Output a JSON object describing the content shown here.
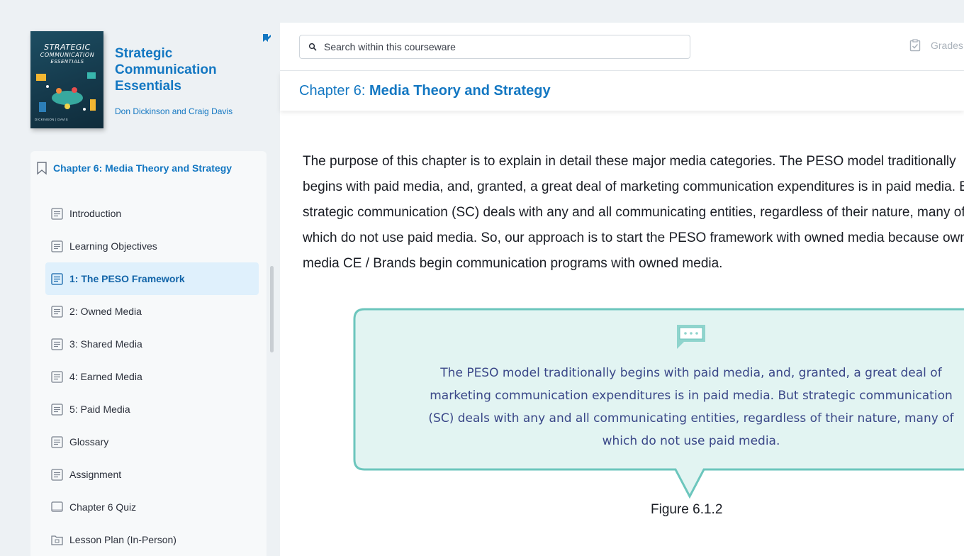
{
  "book": {
    "title": "Strategic Communication Essentials",
    "authors": "Don Dickinson and Craig Davis",
    "cover": {
      "title_line1": "STRATEGIC",
      "title_line2": "COMMUNICATION",
      "title_line3": "ESSENTIALS",
      "authors": "DICKINSON | DAVIS"
    }
  },
  "toc": {
    "chapter": "Chapter 6: Media Theory and Strategy",
    "items": [
      {
        "label": "Introduction",
        "icon": "document-icon"
      },
      {
        "label": "Learning Objectives",
        "icon": "document-icon"
      },
      {
        "label": "1: The PESO Framework",
        "icon": "document-icon",
        "active": true
      },
      {
        "label": "2: Owned Media",
        "icon": "document-icon"
      },
      {
        "label": "3: Shared Media",
        "icon": "document-icon"
      },
      {
        "label": "4: Earned Media",
        "icon": "document-icon"
      },
      {
        "label": "5: Paid Media",
        "icon": "document-icon"
      },
      {
        "label": "Glossary",
        "icon": "document-icon"
      },
      {
        "label": "Assignment",
        "icon": "document-icon"
      },
      {
        "label": "Chapter 6 Quiz",
        "icon": "quiz-icon"
      },
      {
        "label": "Lesson Plan (In-Person)",
        "icon": "folder-icon"
      }
    ]
  },
  "topbar": {
    "search_placeholder": "Search within this courseware",
    "grades_label": "Grades"
  },
  "chapter_header": {
    "prefix": "Chapter 6: ",
    "title": "Media Theory and Strategy"
  },
  "content": {
    "lines": [
      "The purpose of this chapter is to explain in detail these major media categories. The PESO model traditionally",
      "begins with paid media, and, granted, a great deal of marketing communication expenditures is in paid media. But",
      "strategic communication (SC) deals with any and all communicating entities, regardless of their nature, many of",
      "which do not use paid media. So, our approach is to start the PESO framework with owned media because owned",
      "media CE / Brands begin communication programs with owned media."
    ],
    "callout_lines": [
      "The PESO model traditionally begins with paid media, and, granted, a great deal of",
      "marketing communication expenditures is in paid media. But strategic communication",
      "(SC) deals with any and all communicating entities, regardless of their nature, many of",
      "which do not use paid media."
    ],
    "figure_caption": "Figure 6.1.2"
  },
  "colors": {
    "accent": "#1377c2",
    "active_bg": "#dff0fc",
    "callout_bg": "#e2f4f2",
    "callout_border": "#6cc6bd",
    "callout_text": "#3a4788"
  }
}
